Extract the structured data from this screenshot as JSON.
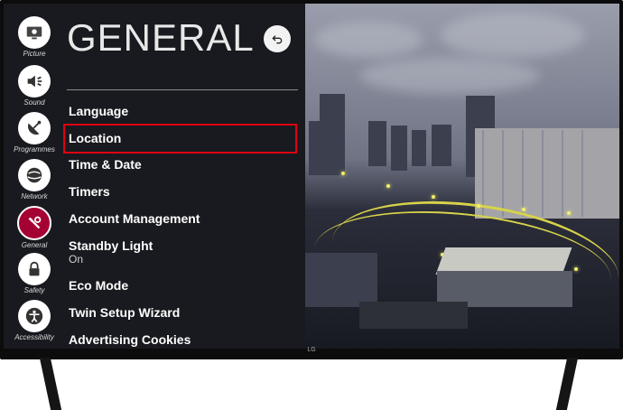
{
  "header": {
    "title": "GENERAL"
  },
  "categories": [
    {
      "label": "Picture",
      "icon": "picture-icon"
    },
    {
      "label": "Sound",
      "icon": "sound-icon"
    },
    {
      "label": "Programmes",
      "icon": "satellite-icon"
    },
    {
      "label": "Network",
      "icon": "globe-icon"
    },
    {
      "label": "General",
      "icon": "general-icon",
      "active": true
    },
    {
      "label": "Safety",
      "icon": "lock-icon"
    },
    {
      "label": "Accessibility",
      "icon": "accessibility-icon"
    }
  ],
  "menu": {
    "items": [
      {
        "label": "Language"
      },
      {
        "label": "Location",
        "highlighted": true
      },
      {
        "label": "Time & Date"
      },
      {
        "label": "Timers"
      },
      {
        "label": "Account Management"
      },
      {
        "label": "Standby Light",
        "value": "On"
      },
      {
        "label": "Eco Mode"
      },
      {
        "label": "Twin Setup Wizard"
      },
      {
        "label": "Advertising Cookies"
      }
    ]
  },
  "tv": {
    "logo": "LG"
  },
  "colors": {
    "active_category": "#a50034",
    "highlight_border": "#e00012",
    "road_lights": "#d8d34a"
  }
}
